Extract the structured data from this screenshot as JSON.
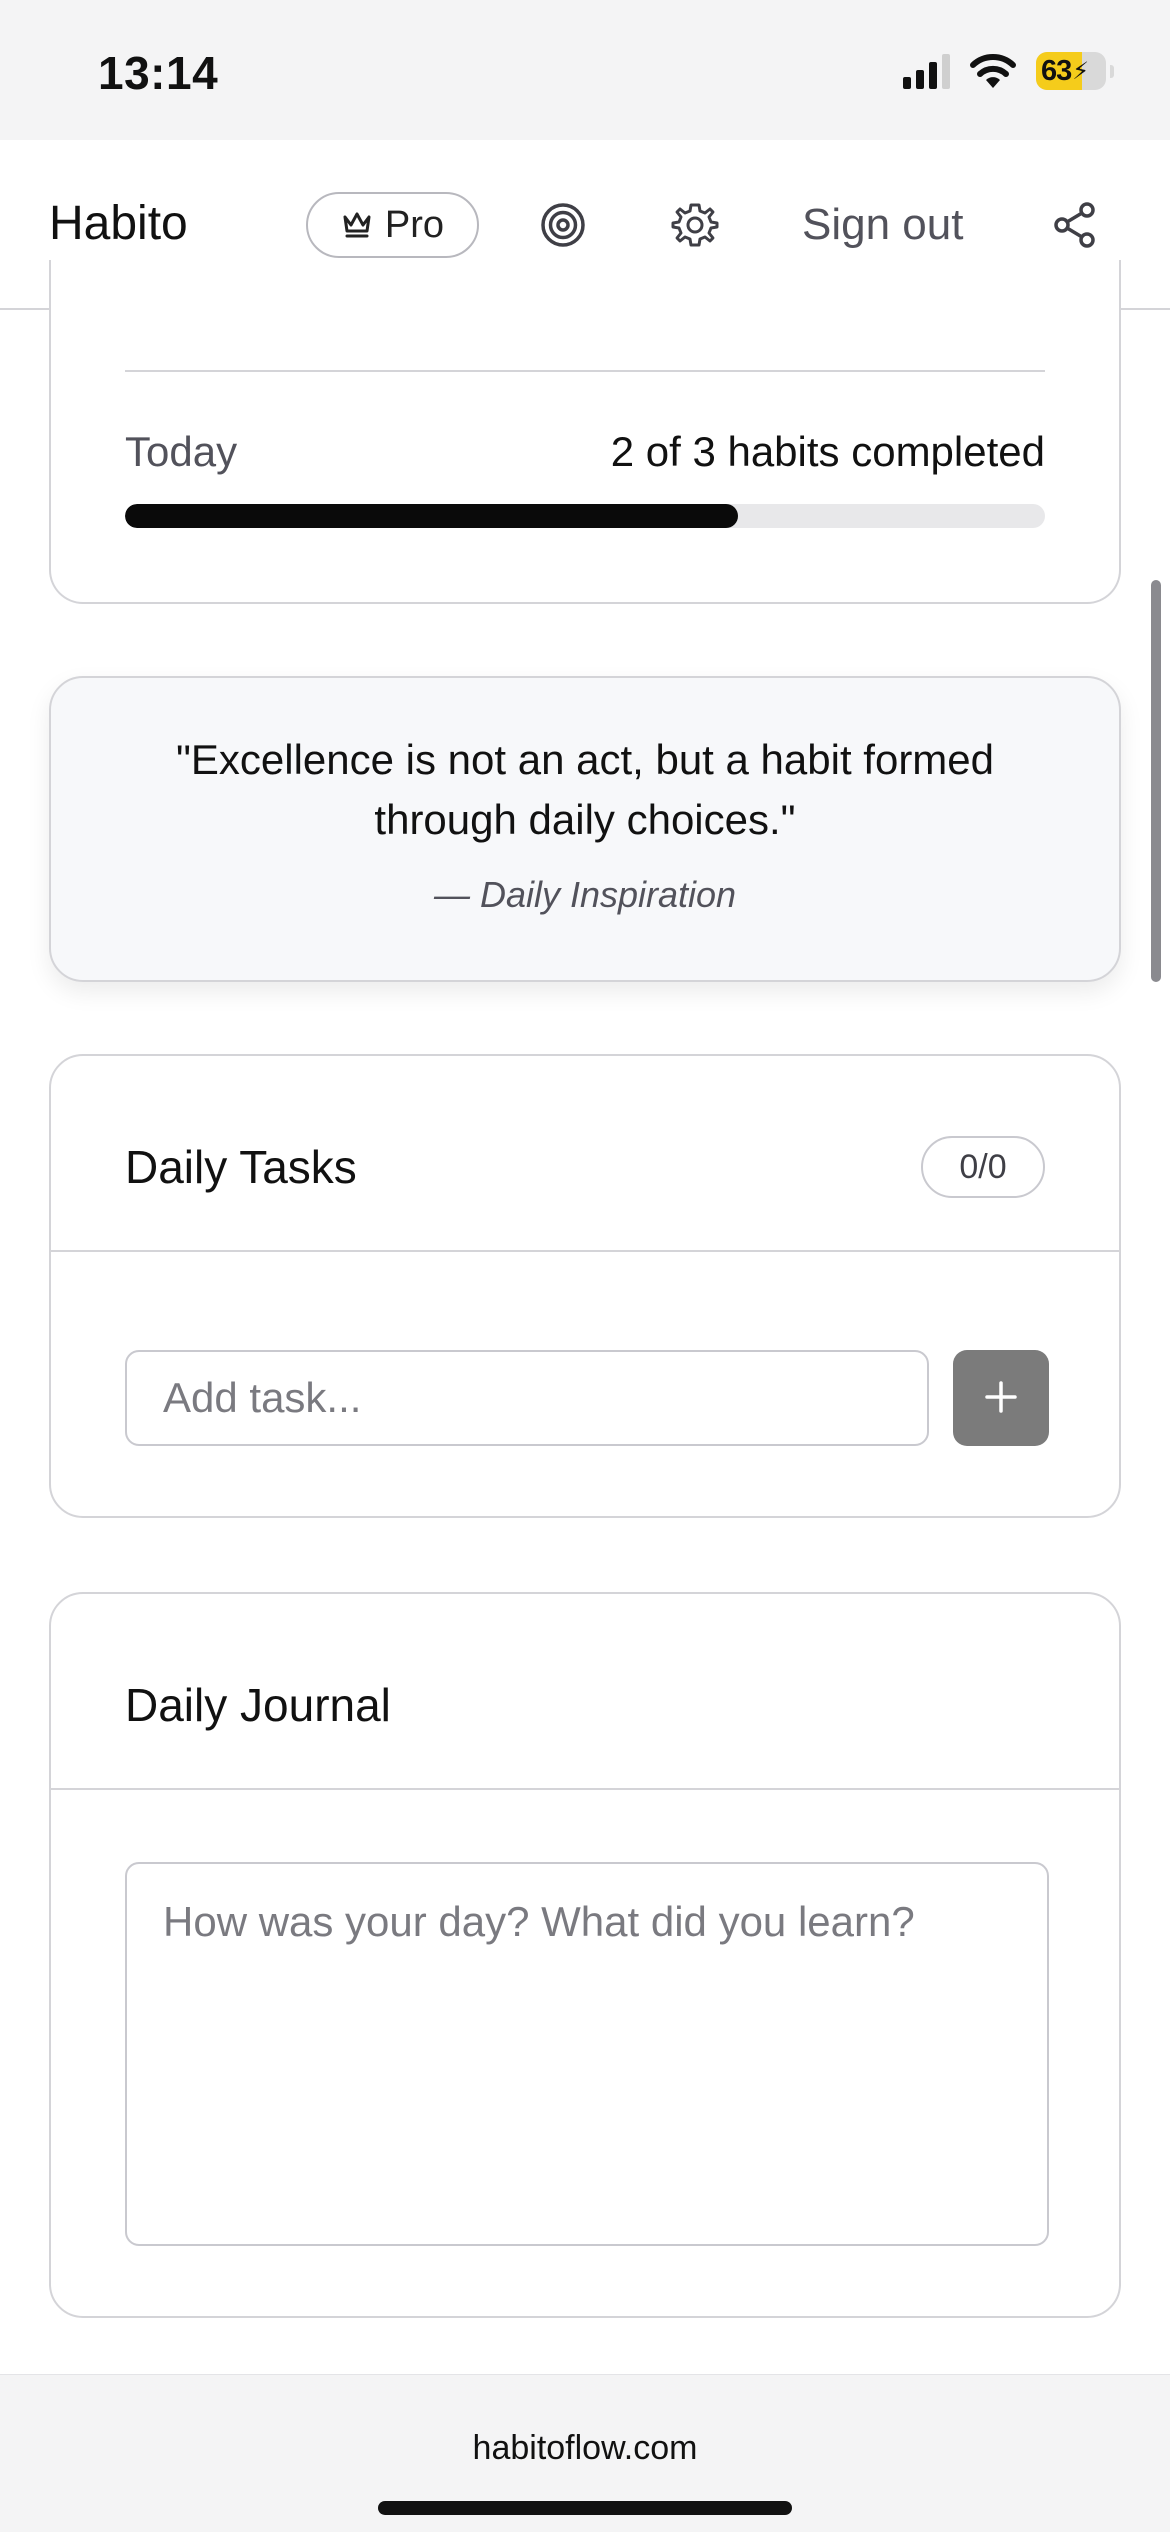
{
  "status_bar": {
    "time": "13:14",
    "battery": "63"
  },
  "header": {
    "brand": "Habito",
    "pro_label": "Pro",
    "sign_out_label": "Sign out"
  },
  "progress_card": {
    "today_label": "Today",
    "status_text": "2 of 3 habits completed",
    "completed": 2,
    "total": 3
  },
  "quote_card": {
    "text": "\"Excellence is not an act, but a habit formed through daily choices.\"",
    "attribution": "— Daily Inspiration"
  },
  "tasks_card": {
    "title": "Daily Tasks",
    "count": "0/0",
    "input_placeholder": "Add task..."
  },
  "journal_card": {
    "title": "Daily Journal",
    "placeholder": "How was your day? What did you learn?"
  },
  "browser": {
    "url": "habitoflow.com"
  },
  "colors": {
    "accent": "#0a0a0a",
    "add_button": "#7b7b7b",
    "battery": "#f5cc1b"
  }
}
